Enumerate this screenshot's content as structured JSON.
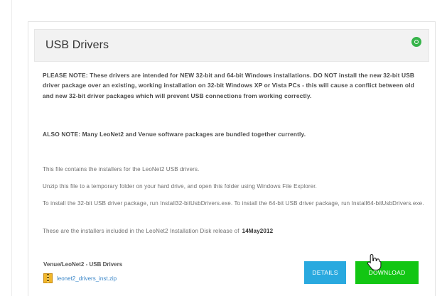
{
  "panel": {
    "title": "USB Drivers",
    "collapse_icon": "circle-minus-icon",
    "accent_color": "#36b44a"
  },
  "notes": {
    "note_1": "PLEASE NOTE: These drivers are intended for NEW 32-bit and 64-bit Windows installations. DO NOT install the new 32-bit USB driver package over an existing, working installation on 32-bit Windows XP or Vista PCs - this will cause a conflict between old and new 32-bit driver packages which will prevent USB connections from working correctly.",
    "note_2": "ALSO NOTE: Many LeoNet2 and Venue software packages are bundled together currently."
  },
  "description": {
    "line_1": "This file contains the installers for the LeoNet2 USB drivers.",
    "line_2": "Unzip this file to a temporary folder on your hard drive, and open this folder using Windows File Explorer.",
    "line_3": "To install the 32-bit USB driver package, run Install32-bitUsbDrivers.exe. To install the 64-bit USB driver package, run Install64-bitUsbDrivers.exe.",
    "line_4": "These are the installers included in the LeoNet2 Installation Disk release of",
    "release_date": "14May2012"
  },
  "file": {
    "title": "Venue/LeoNet2 - USB Drivers",
    "name": "leonet2_drivers_inst.zip",
    "icon": "zip-file-icon"
  },
  "buttons": {
    "details": "DETAILS",
    "download": "DOWNLOAD",
    "details_color": "#29a9df",
    "download_color": "#12c613"
  },
  "cursor_icon": "hand-pointer-icon"
}
